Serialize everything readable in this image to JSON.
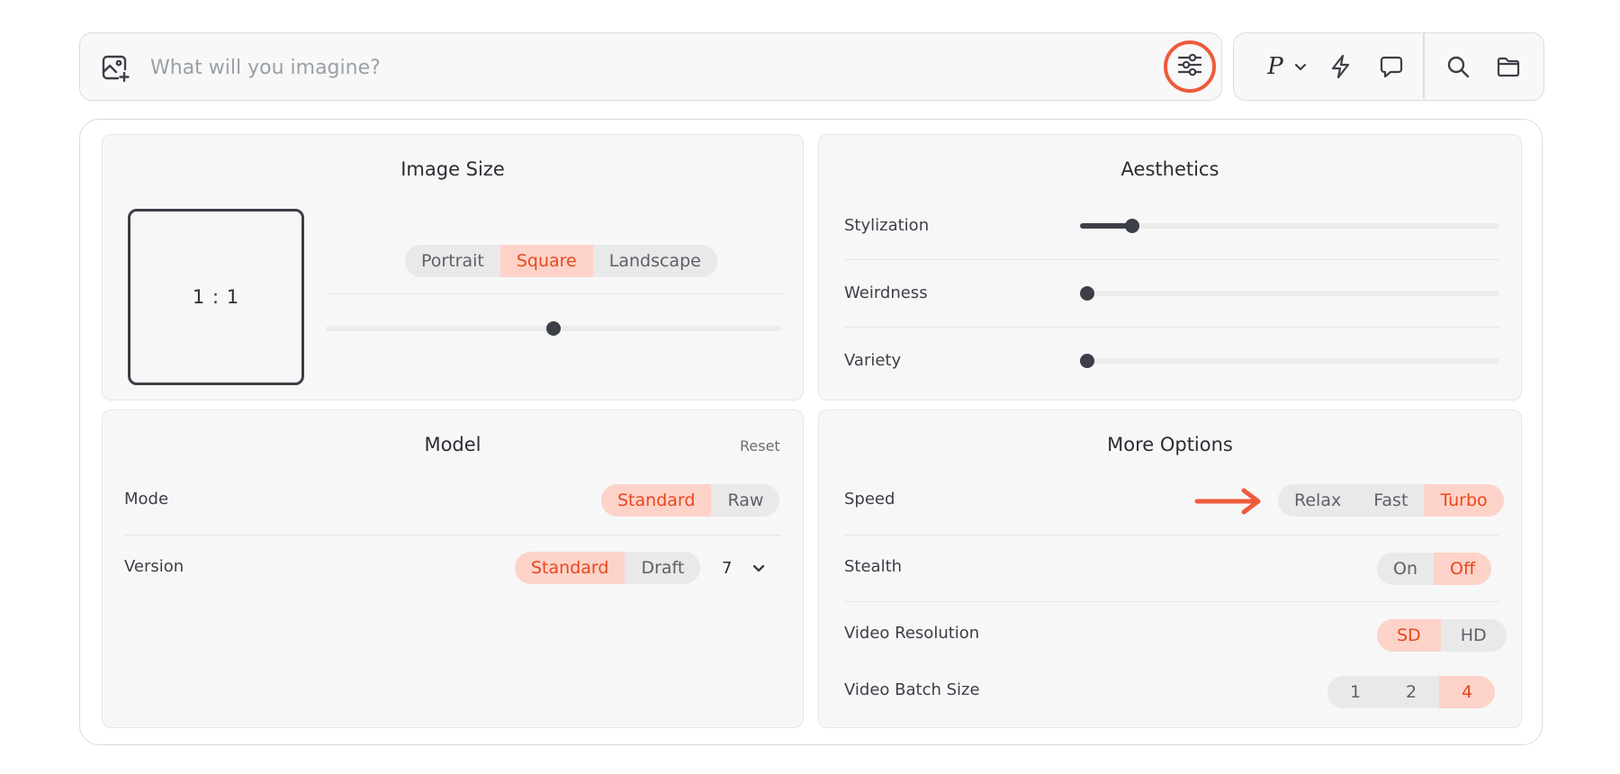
{
  "prompt": {
    "placeholder": "What will you imagine?",
    "value": ""
  },
  "tools": {
    "personalize_letter": "P",
    "icons": [
      "image-plus-icon",
      "settings-sliders-icon",
      "chevron-down-icon",
      "lightning-icon",
      "chat-bubble-icon",
      "search-icon",
      "folder-icon"
    ]
  },
  "colors": {
    "accent": "#ef5a3c",
    "active_bg": "#fdd3c9",
    "active_text": "#e8461e",
    "knob": "#3c3f47"
  },
  "image_size": {
    "title": "Image Size",
    "ratio": "1 : 1",
    "orientation_options": [
      "Portrait",
      "Square",
      "Landscape"
    ],
    "selected": "Square",
    "slider_value": 0.5
  },
  "aesthetics": {
    "title": "Aesthetics",
    "rows": [
      {
        "label": "Stylization",
        "value": 0.12
      },
      {
        "label": "Weirdness",
        "value": 0
      },
      {
        "label": "Variety",
        "value": 0
      }
    ]
  },
  "model": {
    "title": "Model",
    "reset_label": "Reset",
    "mode": {
      "label": "Mode",
      "options": [
        "Standard",
        "Raw"
      ],
      "selected": "Standard"
    },
    "version": {
      "label": "Version",
      "options": [
        "Standard",
        "Draft"
      ],
      "selected": "Standard",
      "number": "7"
    }
  },
  "more_options": {
    "title": "More Options",
    "speed": {
      "label": "Speed",
      "options": [
        "Relax",
        "Fast",
        "Turbo"
      ],
      "selected": "Turbo"
    },
    "stealth": {
      "label": "Stealth",
      "options": [
        "On",
        "Off"
      ],
      "selected": "Off"
    },
    "video_resolution": {
      "label": "Video Resolution",
      "options": [
        "SD",
        "HD"
      ],
      "selected": "SD"
    },
    "video_batch_size": {
      "label": "Video Batch Size",
      "options": [
        "1",
        "2",
        "4"
      ],
      "selected": "4"
    }
  }
}
